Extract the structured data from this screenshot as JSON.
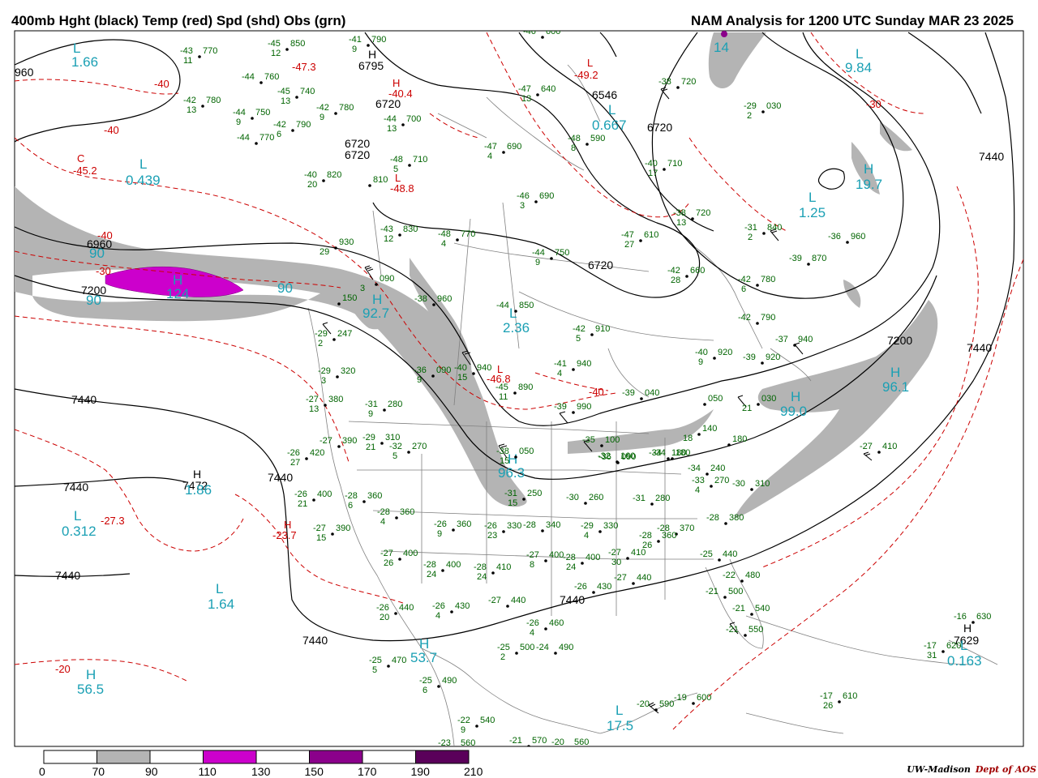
{
  "header": {
    "title_left": "400mb Hght (black) Temp (red) Spd (shd) Obs (grn)",
    "title_right": "NAM Analysis for 1200 UTC Sunday  MAR 23 2025"
  },
  "footer": {
    "credit_org": "UW-Madison",
    "credit_dept": "Dept of AOS"
  },
  "colorbar": {
    "labels": [
      "0",
      "70",
      "90",
      "110",
      "130",
      "150",
      "170",
      "190",
      "210"
    ],
    "fills": [
      "#ffffff",
      "#b4b4b4",
      "#ffffff",
      "#cc00cc",
      "#ffffff",
      "#8b008b",
      "#ffffff",
      "#5a005a"
    ]
  },
  "colors": {
    "height": "#000000",
    "temperature": "#cc0000",
    "obs": "#006400",
    "speed_label": "#1ba0b4",
    "shade_70": "#b4b4b4",
    "shade_110": "#cc00cc",
    "state_lines": "#808080"
  },
  "height_labels": [
    "6960",
    "7200",
    "7440",
    "7440",
    "7440",
    "7440",
    "7440",
    "7440",
    "7200",
    "7440",
    "6720",
    "6720",
    "6720",
    "6720",
    "6546",
    "6795",
    "7472",
    "7629"
  ],
  "temp_labels": [
    "-40",
    "-40",
    "-40",
    "-30",
    "-30",
    "-20",
    "-45.2",
    "-47.3",
    "-40.4",
    "-49.2",
    "-48.8",
    "-46.8",
    "-27.3",
    "-23.7",
    "-40"
  ],
  "speed_labels": [
    "1.66",
    "0.439",
    "0.312",
    "1.64",
    "56.5",
    "53.7",
    "17.5",
    "92.7",
    "2.36",
    "0.667",
    "1.25",
    "9.84",
    "19.7",
    "96.1",
    "99.0",
    "96.3",
    "0.163",
    "1.86",
    "90",
    "90",
    "90",
    "124",
    "14"
  ],
  "observations": [
    {
      "t": "-45",
      "h": "850",
      "d": "12"
    },
    {
      "t": "-43",
      "h": "770",
      "d": "11"
    },
    {
      "t": "-41",
      "h": "790",
      "d": "9"
    },
    {
      "t": "-44",
      "h": "760",
      "d": ""
    },
    {
      "t": "-45",
      "h": "740",
      "d": "13"
    },
    {
      "t": "-42",
      "h": "780",
      "d": "13"
    },
    {
      "t": "-44",
      "h": "750",
      "d": "9"
    },
    {
      "t": "-42",
      "h": "780",
      "d": "9"
    },
    {
      "t": "-42",
      "h": "790",
      "d": "6"
    },
    {
      "t": "-44",
      "h": "770",
      "d": ""
    },
    {
      "t": "-44",
      "h": "700",
      "d": "13"
    },
    {
      "t": "-47",
      "h": "640",
      "d": "13"
    },
    {
      "t": "-47",
      "h": "690",
      "d": "4"
    },
    {
      "t": "-48",
      "h": "590",
      "d": "8"
    },
    {
      "t": "-38",
      "h": "720",
      "d": ""
    },
    {
      "t": "-29",
      "h": "030",
      "d": "2"
    },
    {
      "t": "-40",
      "h": "710",
      "d": "17"
    },
    {
      "t": "-48",
      "h": "710",
      "d": "5"
    },
    {
      "t": "-40",
      "h": "820",
      "d": "20"
    },
    {
      "t": "",
      "h": "810",
      "d": ""
    },
    {
      "t": "-46",
      "h": "690",
      "d": "3"
    },
    {
      "t": "-38",
      "h": "720",
      "d": "13"
    },
    {
      "t": "-31",
      "h": "840",
      "d": "2"
    },
    {
      "t": "-47",
      "h": "610",
      "d": "27"
    },
    {
      "t": "-43",
      "h": "830",
      "d": "12"
    },
    {
      "t": "-48",
      "h": "770",
      "d": "4"
    },
    {
      "t": "-36",
      "h": "960",
      "d": ""
    },
    {
      "t": "-39",
      "h": "870",
      "d": ""
    },
    {
      "t": "-42",
      "h": "660",
      "d": "28"
    },
    {
      "t": "-44",
      "h": "750",
      "d": "9"
    },
    {
      "t": "",
      "h": "930",
      "d": "29"
    },
    {
      "t": "-42",
      "h": "780",
      "d": "6"
    },
    {
      "t": "",
      "h": "090",
      "d": "3"
    },
    {
      "t": "-38",
      "h": "960",
      "d": ""
    },
    {
      "t": "",
      "h": "150",
      "d": ""
    },
    {
      "t": "-44",
      "h": "850",
      "d": ""
    },
    {
      "t": "-42",
      "h": "910",
      "d": "5"
    },
    {
      "t": "-42",
      "h": "790",
      "d": ""
    },
    {
      "t": "-37",
      "h": "940",
      "d": ""
    },
    {
      "t": "-29",
      "h": "247",
      "d": "2"
    },
    {
      "t": "-40",
      "h": "920",
      "d": "9"
    },
    {
      "t": "-39",
      "h": "920",
      "d": ""
    },
    {
      "t": "-29",
      "h": "320",
      "d": "3"
    },
    {
      "t": "-36",
      "h": "090",
      "d": "9"
    },
    {
      "t": "-40",
      "h": "940",
      "d": "15"
    },
    {
      "t": "-41",
      "h": "940",
      "d": "4"
    },
    {
      "t": "-45",
      "h": "890",
      "d": "11"
    },
    {
      "t": "-27",
      "h": "380",
      "d": "13"
    },
    {
      "t": "-31",
      "h": "280",
      "d": "9"
    },
    {
      "t": "-39",
      "h": "990",
      "d": ""
    },
    {
      "t": "-39",
      "h": "040",
      "d": ""
    },
    {
      "t": "",
      "h": "050",
      "d": ""
    },
    {
      "t": "",
      "h": "030",
      "d": "21"
    },
    {
      "t": "-27",
      "h": "390",
      "d": ""
    },
    {
      "t": "-29",
      "h": "310",
      "d": "21"
    },
    {
      "t": "-32",
      "h": "270",
      "d": "5"
    },
    {
      "t": "-35",
      "h": "100",
      "d": ""
    },
    {
      "t": "-36",
      "h": "090",
      "d": ""
    },
    {
      "t": "-38",
      "h": "050",
      "d": "15"
    },
    {
      "t": "-32",
      "h": "160",
      "d": ""
    },
    {
      "t": "-34",
      "h": "180",
      "d": ""
    },
    {
      "t": "",
      "h": "140",
      "d": "18"
    },
    {
      "t": "",
      "h": "180",
      "d": ""
    },
    {
      "t": "-27",
      "h": "410",
      "d": ""
    },
    {
      "t": "-26",
      "h": "420",
      "d": "27"
    },
    {
      "t": "-26",
      "h": "400",
      "d": "21"
    },
    {
      "t": "-28",
      "h": "360",
      "d": "6"
    },
    {
      "t": "-28",
      "h": "360",
      "d": "4"
    },
    {
      "t": "-34",
      "h": "180",
      "d": ""
    },
    {
      "t": "-31",
      "h": "250",
      "d": "15"
    },
    {
      "t": "-30",
      "h": "260",
      "d": ""
    },
    {
      "t": "-31",
      "h": "280",
      "d": ""
    },
    {
      "t": "-34",
      "h": "240",
      "d": ""
    },
    {
      "t": "-33",
      "h": "270",
      "d": "4"
    },
    {
      "t": "-30",
      "h": "310",
      "d": ""
    },
    {
      "t": "-27",
      "h": "390",
      "d": "15"
    },
    {
      "t": "-26",
      "h": "360",
      "d": "9"
    },
    {
      "t": "-26",
      "h": "330",
      "d": "23"
    },
    {
      "t": "-28",
      "h": "340",
      "d": ""
    },
    {
      "t": "-29",
      "h": "330",
      "d": "4"
    },
    {
      "t": "-28",
      "h": "370",
      "d": ""
    },
    {
      "t": "-28",
      "h": "380",
      "d": ""
    },
    {
      "t": "-27",
      "h": "400",
      "d": "26"
    },
    {
      "t": "-28",
      "h": "400",
      "d": "24"
    },
    {
      "t": "-28",
      "h": "410",
      "d": "24"
    },
    {
      "t": "-27",
      "h": "400",
      "d": "8"
    },
    {
      "t": "-28",
      "h": "400",
      "d": "24"
    },
    {
      "t": "-27",
      "h": "410",
      "d": "30"
    },
    {
      "t": "-28",
      "h": "360",
      "d": "26"
    },
    {
      "t": "-25",
      "h": "440",
      "d": ""
    },
    {
      "t": "-26",
      "h": "440",
      "d": "20"
    },
    {
      "t": "-26",
      "h": "430",
      "d": "4"
    },
    {
      "t": "-27",
      "h": "440",
      "d": ""
    },
    {
      "t": "-26",
      "h": "430",
      "d": ""
    },
    {
      "t": "-27",
      "h": "440",
      "d": ""
    },
    {
      "t": "-22",
      "h": "480",
      "d": ""
    },
    {
      "t": "-21",
      "h": "500",
      "d": ""
    },
    {
      "t": "-21",
      "h": "540",
      "d": ""
    },
    {
      "t": "-21",
      "h": "550",
      "d": ""
    },
    {
      "t": "-26",
      "h": "460",
      "d": "4"
    },
    {
      "t": "-25",
      "h": "470",
      "d": "5"
    },
    {
      "t": "-25",
      "h": "500",
      "d": "2"
    },
    {
      "t": "-24",
      "h": "490",
      "d": ""
    },
    {
      "t": "-25",
      "h": "490",
      "d": "6"
    },
    {
      "t": "-22",
      "h": "540",
      "d": "9"
    },
    {
      "t": "-23",
      "h": "560",
      "d": ""
    },
    {
      "t": "-21",
      "h": "570",
      "d": ""
    },
    {
      "t": "-20",
      "h": "560",
      "d": ""
    },
    {
      "t": "-20",
      "h": "590",
      "d": ""
    },
    {
      "t": "-19",
      "h": "600",
      "d": ""
    },
    {
      "t": "-16",
      "h": "630",
      "d": ""
    },
    {
      "t": "-17",
      "h": "620",
      "d": "31"
    },
    {
      "t": "-17",
      "h": "610",
      "d": "26"
    },
    {
      "t": "-46",
      "h": "600",
      "d": ""
    }
  ]
}
